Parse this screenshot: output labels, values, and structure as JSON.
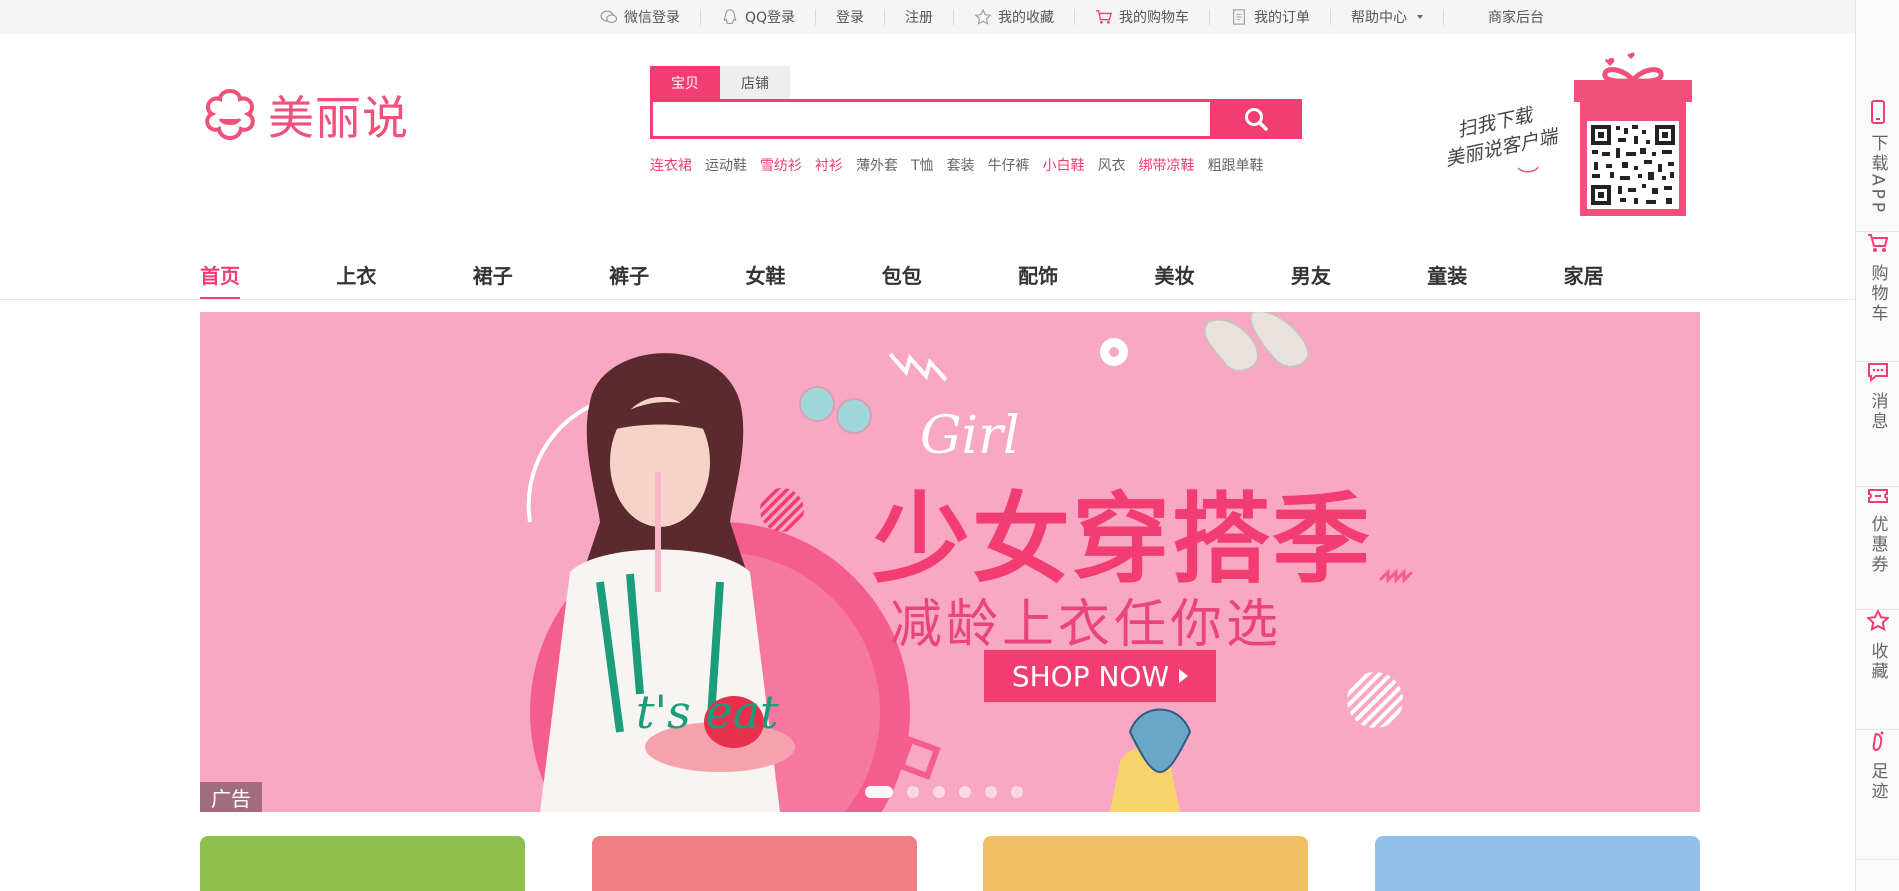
{
  "topbar": {
    "items": [
      {
        "label": "微信登录",
        "icon": "wechat-icon"
      },
      {
        "label": "QQ登录",
        "icon": "qq-icon"
      },
      {
        "label": "登录"
      },
      {
        "label": "注册"
      },
      {
        "label": "我的收藏",
        "icon": "star-icon"
      },
      {
        "label": "我的购物车",
        "icon": "cart-icon"
      },
      {
        "label": "我的订单",
        "icon": "order-icon"
      },
      {
        "label": "帮助中心",
        "icon": "chevron-down-icon"
      },
      {
        "label": "商家后台"
      }
    ]
  },
  "logo": {
    "text": "美丽说"
  },
  "search": {
    "tabs": [
      "宝贝",
      "店铺"
    ],
    "active_tab": "宝贝",
    "value": "",
    "hot_words": [
      {
        "label": "连衣裙",
        "highlight": true
      },
      {
        "label": "运动鞋",
        "highlight": false
      },
      {
        "label": "雪纺衫",
        "highlight": true
      },
      {
        "label": "衬衫",
        "highlight": true
      },
      {
        "label": "薄外套",
        "highlight": false
      },
      {
        "label": "T恤",
        "highlight": false
      },
      {
        "label": "套装",
        "highlight": false
      },
      {
        "label": "牛仔裤",
        "highlight": false
      },
      {
        "label": "小白鞋",
        "highlight": true
      },
      {
        "label": "风衣",
        "highlight": false
      },
      {
        "label": "绑带凉鞋",
        "highlight": true
      },
      {
        "label": "粗跟单鞋",
        "highlight": false
      }
    ]
  },
  "app_promo": {
    "line1": "扫我下载",
    "line2": "美丽说客户端"
  },
  "nav": {
    "items": [
      "首页",
      "上衣",
      "裙子",
      "裤子",
      "女鞋",
      "包包",
      "配饰",
      "美妆",
      "男友",
      "童装",
      "家居"
    ],
    "active": "首页"
  },
  "banner": {
    "girl_text": "Girl",
    "title": "少女穿搭季",
    "subtitle": "减龄上衣任你选",
    "button": "SHOP NOW",
    "ad_tag": "广告",
    "slide_count": 6,
    "active_slide": 1,
    "shirt_text": "t's eat"
  },
  "cards": [
    {
      "label": "",
      "color": "#8fc04e"
    },
    {
      "label": "",
      "color": "#ef7e85"
    },
    {
      "label": "",
      "color": "#f0bf63"
    },
    {
      "label": "",
      "color": "#93c0ea"
    }
  ],
  "sidebar": {
    "items": [
      {
        "label": "下载APP",
        "icon": "phone-icon"
      },
      {
        "label": "购物车",
        "icon": "cart-icon"
      },
      {
        "label": "消息",
        "icon": "message-icon"
      },
      {
        "label": "优惠券",
        "icon": "coupon-icon"
      },
      {
        "label": "收藏",
        "icon": "star-icon"
      },
      {
        "label": "足迹",
        "icon": "footprint-icon"
      }
    ]
  },
  "colors": {
    "brand": "#f23d73",
    "banner_bg": "#f9a8c3"
  }
}
